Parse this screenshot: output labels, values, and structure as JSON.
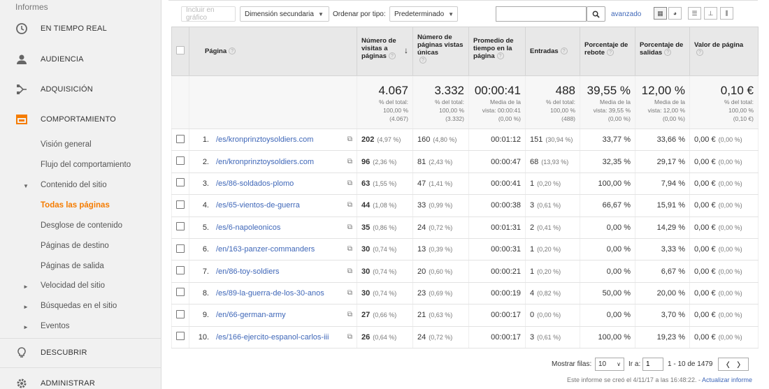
{
  "sidebar": {
    "top_label": "Informes",
    "main_items": [
      {
        "label": "EN TIEMPO REAL",
        "icon": "clock-icon"
      },
      {
        "label": "AUDIENCIA",
        "icon": "person-icon"
      },
      {
        "label": "ADQUISICIÓN",
        "icon": "acquisition-icon"
      },
      {
        "label": "COMPORTAMIENTO",
        "icon": "behavior-icon"
      }
    ],
    "behavior_sub": [
      {
        "label": "Visión general"
      },
      {
        "label": "Flujo del comportamiento"
      },
      {
        "label": "Contenido del sitio",
        "arrow": "▼"
      },
      {
        "label": "Todas las páginas"
      },
      {
        "label": "Desglose de contenido"
      },
      {
        "label": "Páginas de destino"
      },
      {
        "label": "Páginas de salida"
      },
      {
        "label": "Velocidad del sitio",
        "arrow": "►"
      },
      {
        "label": "Búsquedas en el sitio",
        "arrow": "►"
      },
      {
        "label": "Eventos",
        "arrow": "►"
      }
    ],
    "discover": {
      "label": "DESCUBRIR",
      "icon": "lightbulb-icon"
    },
    "admin": {
      "label": "ADMINISTRAR",
      "icon": "gear-icon"
    }
  },
  "toolbar": {
    "include_chart": "Incluir en gráfico",
    "secondary_dimension": "Dimensión secundaria",
    "sort_by_label": "Ordenar por tipo:",
    "sort_value": "Predeterminado",
    "search_value": "",
    "advanced": "avanzado"
  },
  "table": {
    "headers": {
      "page": "Página",
      "pageviews": "Número de visitas a páginas",
      "unique": "Número de páginas vistas únicas",
      "avg_time": "Promedio de tiempo en la página",
      "entrances": "Entradas",
      "bounce": "Porcentaje de rebote",
      "exit": "Porcentaje de salidas",
      "value": "Valor de página"
    },
    "totals": {
      "pageviews": {
        "big": "4.067",
        "l1": "% del total:",
        "l2": "100,00 %",
        "l3": "(4.067)"
      },
      "unique": {
        "big": "3.332",
        "l1": "% del total:",
        "l2": "100,00 %",
        "l3": "(3.332)"
      },
      "avg_time": {
        "big": "00:00:41",
        "l1": "Media de la",
        "l2": "vista: 00:00:41",
        "l3": "(0,00 %)"
      },
      "entrances": {
        "big": "488",
        "l1": "% del total:",
        "l2": "100,00 %",
        "l3": "(488)"
      },
      "bounce": {
        "big": "39,55 %",
        "l1": "Media de la",
        "l2": "vista: 39,55 %",
        "l3": "(0,00 %)"
      },
      "exit": {
        "big": "12,00 %",
        "l1": "Media de la",
        "l2": "vista: 12,00 %",
        "l3": "(0,00 %)"
      },
      "value": {
        "big": "0,10 €",
        "l1": "% del total:",
        "l2": "100,00 %",
        "l3": "(0,10 €)"
      }
    },
    "rows": [
      {
        "n": "1.",
        "page": "/es/kronprinztoysoldiers.com",
        "pv": "202",
        "pv_p": "(4,97 %)",
        "u": "160",
        "u_p": "(4,80 %)",
        "t": "00:01:12",
        "e": "151",
        "e_p": "(30,94 %)",
        "b": "33,77 %",
        "x": "33,66 %",
        "v": "0,00 €",
        "v_p": "(0,00 %)"
      },
      {
        "n": "2.",
        "page": "/en/kronprinztoysoldiers.com",
        "pv": "96",
        "pv_p": "(2,36 %)",
        "u": "81",
        "u_p": "(2,43 %)",
        "t": "00:00:47",
        "e": "68",
        "e_p": "(13,93 %)",
        "b": "32,35 %",
        "x": "29,17 %",
        "v": "0,00 €",
        "v_p": "(0,00 %)"
      },
      {
        "n": "3.",
        "page": "/es/86-soldados-plomo",
        "pv": "63",
        "pv_p": "(1,55 %)",
        "u": "47",
        "u_p": "(1,41 %)",
        "t": "00:00:41",
        "e": "1",
        "e_p": "(0,20 %)",
        "b": "100,00 %",
        "x": "7,94 %",
        "v": "0,00 €",
        "v_p": "(0,00 %)"
      },
      {
        "n": "4.",
        "page": "/es/65-vientos-de-guerra",
        "pv": "44",
        "pv_p": "(1,08 %)",
        "u": "33",
        "u_p": "(0,99 %)",
        "t": "00:00:38",
        "e": "3",
        "e_p": "(0,61 %)",
        "b": "66,67 %",
        "x": "15,91 %",
        "v": "0,00 €",
        "v_p": "(0,00 %)"
      },
      {
        "n": "5.",
        "page": "/es/6-napoleonicos",
        "pv": "35",
        "pv_p": "(0,86 %)",
        "u": "24",
        "u_p": "(0,72 %)",
        "t": "00:01:31",
        "e": "2",
        "e_p": "(0,41 %)",
        "b": "0,00 %",
        "x": "14,29 %",
        "v": "0,00 €",
        "v_p": "(0,00 %)"
      },
      {
        "n": "6.",
        "page": "/en/163-panzer-commanders",
        "pv": "30",
        "pv_p": "(0,74 %)",
        "u": "13",
        "u_p": "(0,39 %)",
        "t": "00:00:31",
        "e": "1",
        "e_p": "(0,20 %)",
        "b": "0,00 %",
        "x": "3,33 %",
        "v": "0,00 €",
        "v_p": "(0,00 %)"
      },
      {
        "n": "7.",
        "page": "/en/86-toy-soldiers",
        "pv": "30",
        "pv_p": "(0,74 %)",
        "u": "20",
        "u_p": "(0,60 %)",
        "t": "00:00:21",
        "e": "1",
        "e_p": "(0,20 %)",
        "b": "0,00 %",
        "x": "6,67 %",
        "v": "0,00 €",
        "v_p": "(0,00 %)"
      },
      {
        "n": "8.",
        "page": "/es/89-la-guerra-de-los-30-anos",
        "pv": "30",
        "pv_p": "(0,74 %)",
        "u": "23",
        "u_p": "(0,69 %)",
        "t": "00:00:19",
        "e": "4",
        "e_p": "(0,82 %)",
        "b": "50,00 %",
        "x": "20,00 %",
        "v": "0,00 €",
        "v_p": "(0,00 %)"
      },
      {
        "n": "9.",
        "page": "/en/66-german-army",
        "pv": "27",
        "pv_p": "(0,66 %)",
        "u": "21",
        "u_p": "(0,63 %)",
        "t": "00:00:17",
        "e": "0",
        "e_p": "(0,00 %)",
        "b": "0,00 %",
        "x": "3,70 %",
        "v": "0,00 €",
        "v_p": "(0,00 %)"
      },
      {
        "n": "10.",
        "page": "/es/166-ejercito-espanol-carlos-iii",
        "pv": "26",
        "pv_p": "(0,64 %)",
        "u": "24",
        "u_p": "(0,72 %)",
        "t": "00:00:17",
        "e": "3",
        "e_p": "(0,61 %)",
        "b": "100,00 %",
        "x": "19,23 %",
        "v": "0,00 €",
        "v_p": "(0,00 %)"
      }
    ]
  },
  "pager": {
    "show_rows_label": "Mostrar filas:",
    "rows_value": "10",
    "goto_label": "Ir a:",
    "goto_value": "1",
    "range": "1 - 10 de 1479"
  },
  "footer": {
    "note": "Este informe se creó el 4/11/17 a las 16:48:22. - ",
    "refresh": "Actualizar informe"
  },
  "colors": {
    "accent": "#f57c00",
    "link": "#3f67b8"
  }
}
